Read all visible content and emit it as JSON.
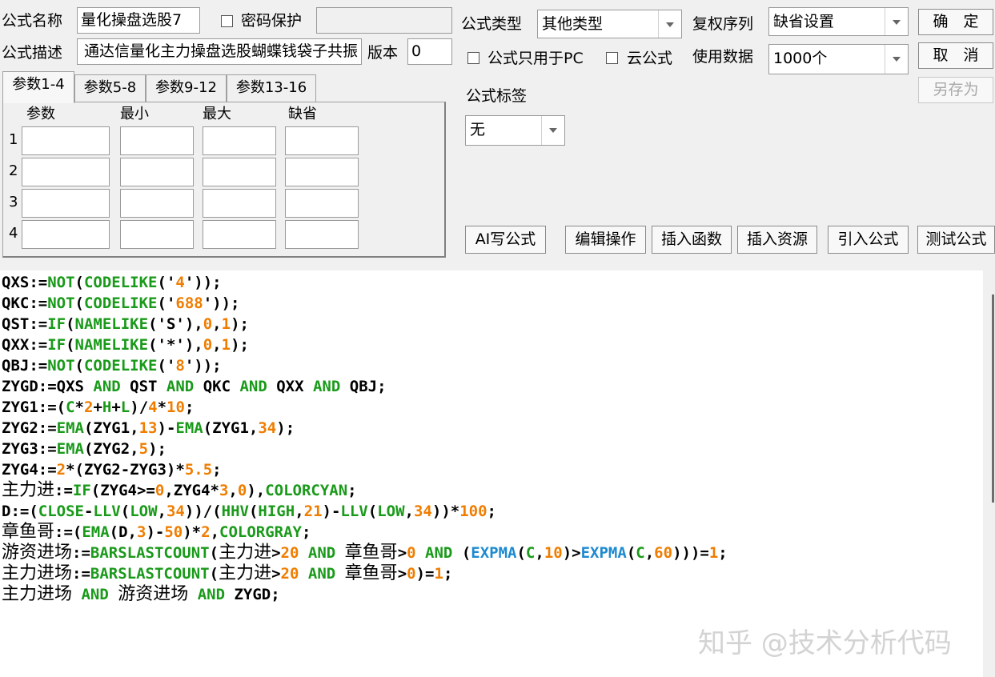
{
  "form": {
    "name_label": "公式名称",
    "name_value": "量化操盘选股7",
    "password_label": "密码保护",
    "password_value": "",
    "desc_label": "公式描述",
    "desc_value": "通达信量化主力操盘选股蝴蝶钱袋子共振",
    "version_label": "版本",
    "version_value": "0",
    "type_label": "公式类型",
    "type_value": "其他类型",
    "pc_only_label": "公式只用于PC",
    "cloud_label": "云公式",
    "rights_label": "复权序列",
    "rights_value": "缺省设置",
    "data_label": "使用数据",
    "data_value": "1000个",
    "tag_label": "公式标签",
    "tag_value": "无"
  },
  "buttons": {
    "ok": "确　定",
    "cancel": "取　消",
    "save_as": "另存为",
    "ai_write": "AI写公式",
    "edit_ops": "编辑操作",
    "insert_func": "插入函数",
    "insert_res": "插入资源",
    "import_formula": "引入公式",
    "test_formula": "测试公式"
  },
  "param_tabs": [
    "参数1-4",
    "参数5-8",
    "参数9-12",
    "参数13-16"
  ],
  "param_headers": [
    "参数",
    "最小",
    "最大",
    "缺省"
  ],
  "param_rows": [
    "1",
    "2",
    "3",
    "4"
  ],
  "code_colors": {
    "plain": "#000000",
    "keyword": "#1a9a1a",
    "number": "#f07d00",
    "func_blue": "#1d8ad0"
  },
  "code_lines": [
    [
      [
        "p",
        "QXS:="
      ],
      [
        "k",
        "NOT"
      ],
      [
        "p",
        "("
      ],
      [
        "k",
        "CODELIKE"
      ],
      [
        "p",
        "('"
      ],
      [
        "n",
        "4"
      ],
      [
        "p",
        "'));"
      ]
    ],
    [
      [
        "p",
        "QKC:="
      ],
      [
        "k",
        "NOT"
      ],
      [
        "p",
        "("
      ],
      [
        "k",
        "CODELIKE"
      ],
      [
        "p",
        "('"
      ],
      [
        "n",
        "688"
      ],
      [
        "p",
        "'));"
      ]
    ],
    [
      [
        "p",
        "QST:="
      ],
      [
        "k",
        "IF"
      ],
      [
        "p",
        "("
      ],
      [
        "k",
        "NAMELIKE"
      ],
      [
        "p",
        "('S'),"
      ],
      [
        "n",
        "0"
      ],
      [
        "p",
        ","
      ],
      [
        "n",
        "1"
      ],
      [
        "p",
        ");"
      ]
    ],
    [
      [
        "p",
        "QXX:="
      ],
      [
        "k",
        "IF"
      ],
      [
        "p",
        "("
      ],
      [
        "k",
        "NAMELIKE"
      ],
      [
        "p",
        "('*'),"
      ],
      [
        "n",
        "0"
      ],
      [
        "p",
        ","
      ],
      [
        "n",
        "1"
      ],
      [
        "p",
        ");"
      ]
    ],
    [
      [
        "p",
        "QBJ:="
      ],
      [
        "k",
        "NOT"
      ],
      [
        "p",
        "("
      ],
      [
        "k",
        "CODELIKE"
      ],
      [
        "p",
        "('"
      ],
      [
        "n",
        "8"
      ],
      [
        "p",
        "'));"
      ]
    ],
    [
      [
        "p",
        "ZYGD:=QXS "
      ],
      [
        "k",
        "AND"
      ],
      [
        "p",
        " QST "
      ],
      [
        "k",
        "AND"
      ],
      [
        "p",
        " QKC "
      ],
      [
        "k",
        "AND"
      ],
      [
        "p",
        " QXX "
      ],
      [
        "k",
        "AND"
      ],
      [
        "p",
        " QBJ;"
      ]
    ],
    [
      [
        "p",
        "ZYG1:=("
      ],
      [
        "k",
        "C"
      ],
      [
        "p",
        "*"
      ],
      [
        "n",
        "2"
      ],
      [
        "p",
        "+"
      ],
      [
        "k",
        "H"
      ],
      [
        "p",
        "+"
      ],
      [
        "k",
        "L"
      ],
      [
        "p",
        ")/"
      ],
      [
        "n",
        "4"
      ],
      [
        "p",
        "*"
      ],
      [
        "n",
        "10"
      ],
      [
        "p",
        ";"
      ]
    ],
    [
      [
        "p",
        "ZYG2:="
      ],
      [
        "k",
        "EMA"
      ],
      [
        "p",
        "(ZYG1,"
      ],
      [
        "n",
        "13"
      ],
      [
        "p",
        ")-"
      ],
      [
        "k",
        "EMA"
      ],
      [
        "p",
        "(ZYG1,"
      ],
      [
        "n",
        "34"
      ],
      [
        "p",
        ");"
      ]
    ],
    [
      [
        "p",
        "ZYG3:="
      ],
      [
        "k",
        "EMA"
      ],
      [
        "p",
        "(ZYG2,"
      ],
      [
        "n",
        "5"
      ],
      [
        "p",
        ");"
      ]
    ],
    [
      [
        "p",
        "ZYG4:="
      ],
      [
        "n",
        "2"
      ],
      [
        "p",
        "*(ZYG2-ZYG3)*"
      ],
      [
        "n",
        "5.5"
      ],
      [
        "p",
        ";"
      ]
    ],
    [
      [
        "c",
        "主力进"
      ],
      [
        "p",
        ":="
      ],
      [
        "k",
        "IF"
      ],
      [
        "p",
        "(ZYG4>="
      ],
      [
        "n",
        "0"
      ],
      [
        "p",
        ",ZYG4*"
      ],
      [
        "n",
        "3"
      ],
      [
        "p",
        ","
      ],
      [
        "n",
        "0"
      ],
      [
        "p",
        "),"
      ],
      [
        "k",
        "COLORCYAN"
      ],
      [
        "p",
        ";"
      ]
    ],
    [
      [
        "p",
        "D:=("
      ],
      [
        "k",
        "CLOSE"
      ],
      [
        "p",
        "-"
      ],
      [
        "k",
        "LLV"
      ],
      [
        "p",
        "("
      ],
      [
        "k",
        "LOW"
      ],
      [
        "p",
        ","
      ],
      [
        "n",
        "34"
      ],
      [
        "p",
        "))/("
      ],
      [
        "k",
        "HHV"
      ],
      [
        "p",
        "("
      ],
      [
        "k",
        "HIGH"
      ],
      [
        "p",
        ","
      ],
      [
        "n",
        "21"
      ],
      [
        "p",
        ")-"
      ],
      [
        "k",
        "LLV"
      ],
      [
        "p",
        "("
      ],
      [
        "k",
        "LOW"
      ],
      [
        "p",
        ","
      ],
      [
        "n",
        "34"
      ],
      [
        "p",
        "))*"
      ],
      [
        "n",
        "100"
      ],
      [
        "p",
        ";"
      ]
    ],
    [
      [
        "c",
        "章鱼哥"
      ],
      [
        "p",
        ":=("
      ],
      [
        "k",
        "EMA"
      ],
      [
        "p",
        "(D,"
      ],
      [
        "n",
        "3"
      ],
      [
        "p",
        ")-"
      ],
      [
        "n",
        "50"
      ],
      [
        "p",
        ")*"
      ],
      [
        "n",
        "2"
      ],
      [
        "p",
        ","
      ],
      [
        "k",
        "COLORGRAY"
      ],
      [
        "p",
        ";"
      ]
    ],
    [
      [
        "c",
        "游资进场"
      ],
      [
        "p",
        ":="
      ],
      [
        "k",
        "BARSLASTCOUNT"
      ],
      [
        "p",
        "("
      ],
      [
        "c",
        "主力进"
      ],
      [
        "p",
        ">"
      ],
      [
        "n",
        "20"
      ],
      [
        "p",
        " "
      ],
      [
        "k",
        "AND"
      ],
      [
        "p",
        " "
      ],
      [
        "c",
        "章鱼哥"
      ],
      [
        "p",
        ">"
      ],
      [
        "n",
        "0"
      ],
      [
        "p",
        " "
      ],
      [
        "k",
        "AND"
      ],
      [
        "p",
        " ("
      ],
      [
        "b",
        "EXPMA"
      ],
      [
        "p",
        "("
      ],
      [
        "k",
        "C"
      ],
      [
        "p",
        ","
      ],
      [
        "n",
        "10"
      ],
      [
        "p",
        ")>"
      ],
      [
        "b",
        "EXPMA"
      ],
      [
        "p",
        "("
      ],
      [
        "k",
        "C"
      ],
      [
        "p",
        ","
      ],
      [
        "n",
        "60"
      ],
      [
        "p",
        ")))="
      ],
      [
        "n",
        "1"
      ],
      [
        "p",
        ";"
      ]
    ],
    [
      [
        "c",
        "主力进场"
      ],
      [
        "p",
        ":="
      ],
      [
        "k",
        "BARSLASTCOUNT"
      ],
      [
        "p",
        "("
      ],
      [
        "c",
        "主力进"
      ],
      [
        "p",
        ">"
      ],
      [
        "n",
        "20"
      ],
      [
        "p",
        " "
      ],
      [
        "k",
        "AND"
      ],
      [
        "p",
        " "
      ],
      [
        "c",
        "章鱼哥"
      ],
      [
        "p",
        ">"
      ],
      [
        "n",
        "0"
      ],
      [
        "p",
        ")="
      ],
      [
        "n",
        "1"
      ],
      [
        "p",
        ";"
      ]
    ],
    [
      [
        "c",
        "主力进场"
      ],
      [
        "p",
        " "
      ],
      [
        "k",
        "AND"
      ],
      [
        "p",
        " "
      ],
      [
        "c",
        "游资进场"
      ],
      [
        "p",
        " "
      ],
      [
        "k",
        "AND"
      ],
      [
        "p",
        " ZYGD;"
      ]
    ]
  ],
  "watermark": "知乎 @技术分析代码"
}
